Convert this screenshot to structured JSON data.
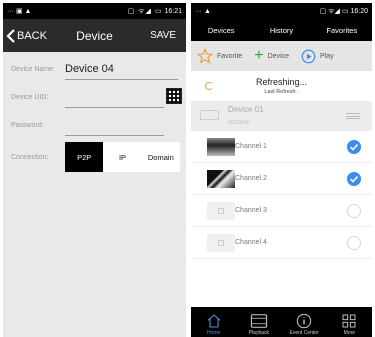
{
  "left": {
    "status": {
      "left_icons": "··· ▣ ▲",
      "right_icons": "▢ ᯤ◢ ▭",
      "time": "16:21"
    },
    "header": {
      "back_label": "BACK",
      "title": "Device",
      "save_label": "SAVE"
    },
    "form": {
      "device_name_label": "Device Name:",
      "device_name_value": "Device 04",
      "device_uid_label": "Device UID:",
      "device_uid_value": "",
      "password_label": "Password:",
      "password_value": ""
    },
    "connection": {
      "label": "Connection:",
      "options": [
        "P2P",
        "IP",
        "Domain"
      ],
      "selected": "P2P"
    }
  },
  "right": {
    "status": {
      "left_icons": "··· ▲",
      "right_icons": "▢ ᯤ◢ ▭",
      "time": "16:20"
    },
    "tabs": [
      "Devices",
      "History",
      "Favorites"
    ],
    "toolbar": {
      "favorite_label": "Favorite",
      "device_label": "Device",
      "play_label": "Play"
    },
    "refresh": {
      "title": "Refreshing...",
      "subtitle": "Last Refresh :"
    },
    "device": {
      "name": "Device 01",
      "id": "001315ch"
    },
    "channels": [
      {
        "name": "Channel 1",
        "checked": true
      },
      {
        "name": "Channel 2",
        "checked": true
      },
      {
        "name": "Channel 3",
        "checked": false
      },
      {
        "name": "Channel 4",
        "checked": false
      }
    ],
    "bottom_nav": [
      {
        "label": "Home",
        "icon": "home-icon"
      },
      {
        "label": "Playback",
        "icon": "playback-icon"
      },
      {
        "label": "Event Center",
        "icon": "info-icon"
      },
      {
        "label": "More",
        "icon": "more-icon"
      }
    ],
    "accent_color": "#3d8cf0"
  }
}
